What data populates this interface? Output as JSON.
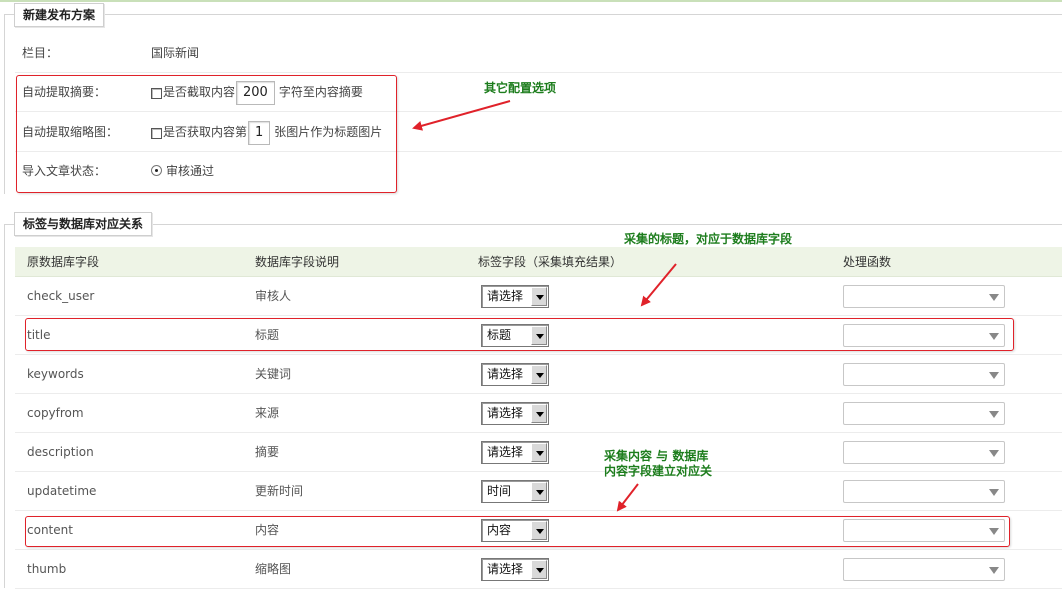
{
  "section1": {
    "legend": "新建发布方案",
    "column": {
      "label": "栏目：",
      "value": "国际新闻"
    },
    "auto_summary": {
      "label": "自动提取摘要：",
      "prefix": "是否截取内容",
      "value": "200",
      "suffix": "字符至内容摘要"
    },
    "auto_thumb": {
      "label": "自动提取缩略图：",
      "prefix": "是否获取内容第",
      "value": "1",
      "suffix": "张图片作为标题图片"
    },
    "import_status": {
      "label": "导入文章状态：",
      "option": "审核通过"
    }
  },
  "section2": {
    "legend": "标签与数据库对应关系",
    "headers": [
      "原数据库字段",
      "数据库字段说明",
      "标签字段（采集填充结果）",
      "处理函数"
    ],
    "rows": [
      {
        "field": "check_user",
        "desc": "审核人",
        "select": "请选择"
      },
      {
        "field": "title",
        "desc": "标题",
        "select": "标题"
      },
      {
        "field": "keywords",
        "desc": "关键词",
        "select": "请选择"
      },
      {
        "field": "copyfrom",
        "desc": "来源",
        "select": "请选择"
      },
      {
        "field": "description",
        "desc": "摘要",
        "select": "请选择"
      },
      {
        "field": "updatetime",
        "desc": "更新时间",
        "select": "时间"
      },
      {
        "field": "content",
        "desc": "内容",
        "select": "内容"
      },
      {
        "field": "thumb",
        "desc": "缩略图",
        "select": "请选择"
      }
    ]
  },
  "annotations": {
    "other_options": "其它配置选项",
    "title_note": "采集的标题，对应于数据库字段",
    "content_note_line1": "采集内容 与 数据库",
    "content_note_line2": "内容字段建立对应关"
  },
  "colors": {
    "annotation_red": "#e0222a",
    "annotation_green": "#1d7d1d",
    "header_bg": "#eef4e6"
  }
}
